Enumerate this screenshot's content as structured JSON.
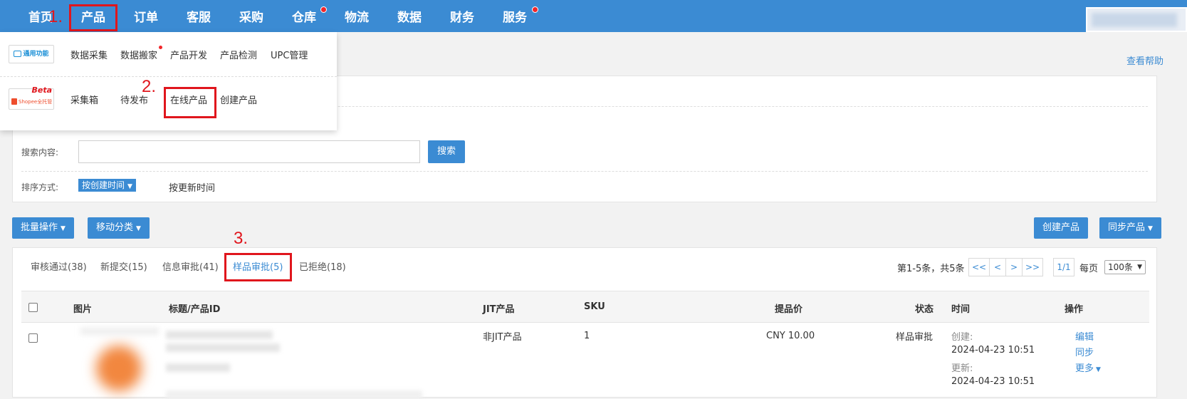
{
  "nav": {
    "items": [
      {
        "label": "首页"
      },
      {
        "label": "产品"
      },
      {
        "label": "订单"
      },
      {
        "label": "客服"
      },
      {
        "label": "采购"
      },
      {
        "label": "仓库"
      },
      {
        "label": "物流"
      },
      {
        "label": "数据"
      },
      {
        "label": "财务"
      },
      {
        "label": "服务"
      }
    ]
  },
  "annotations": {
    "step1": "1.",
    "step2": "2.",
    "step3": "3."
  },
  "dropdown": {
    "row1_logo": "通用功能",
    "row1_items": [
      "数据采集",
      "数据搬家",
      "产品开发",
      "产品检测",
      "UPC管理"
    ],
    "row2_logo_badge": "Beta",
    "row2_logo_text": "Shopee全托管",
    "row2_items": [
      "采集箱",
      "待发布",
      "在线产品",
      "创建产品"
    ]
  },
  "help_link": "查看帮助",
  "filter": {
    "search_label": "搜索内容:",
    "search_placeholder": "",
    "search_button": "搜索",
    "sort_label": "排序方式:",
    "sort_active": "按创建时间",
    "sort_option": "按更新时间"
  },
  "toolbar": {
    "batch_ops": "批量操作",
    "move_category": "移动分类",
    "create_product": "创建产品",
    "sync_product": "同步产品"
  },
  "tabs": [
    {
      "label": "审核通过(38)"
    },
    {
      "label": "新提交(15)"
    },
    {
      "label": "信息审批(41)"
    },
    {
      "label": "样品审批(5)"
    },
    {
      "label": "已拒绝(18)"
    }
  ],
  "pager": {
    "summary": "第1-5条，共5条",
    "first": "<<",
    "prev": "<",
    "next": ">",
    "last": ">>",
    "page": "1/1",
    "per_page_label": "每页",
    "per_page_value": "100条"
  },
  "table": {
    "headers": {
      "image": "图片",
      "title": "标题/产品ID",
      "jit": "JIT产品",
      "sku": "SKU",
      "price": "提品价",
      "status": "状态",
      "time": "时间",
      "actions": "操作"
    },
    "rows": [
      {
        "jit": "非JIT产品",
        "sku": "1",
        "price": "CNY 10.00",
        "status": "样品审批",
        "created_label": "创建:",
        "created": "2024-04-23 10:51",
        "updated_label": "更新:",
        "updated": "2024-04-23 10:51",
        "edit": "编辑",
        "sync": "同步",
        "more": "更多"
      }
    ]
  },
  "colors": {
    "primary": "#3b8bd3",
    "annotation": "#e0161d",
    "notify_dot": "#f2262a"
  }
}
